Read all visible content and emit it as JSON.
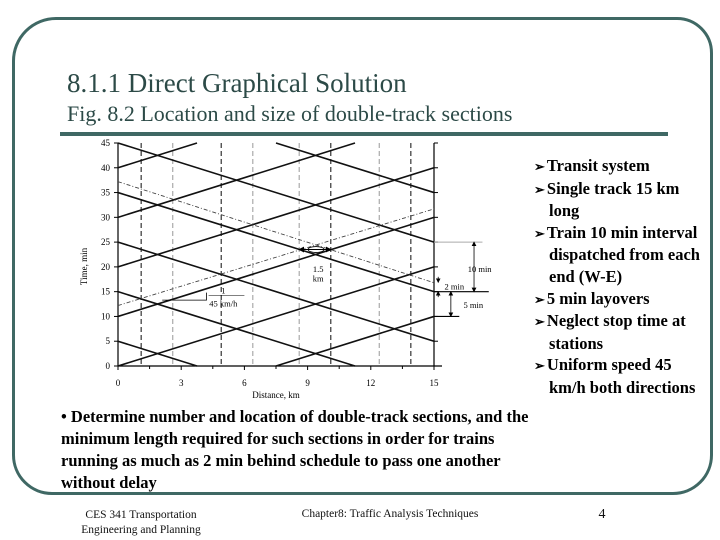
{
  "slide": {
    "title": "8.1.1 Direct Graphical Solution",
    "subtitle": "Fig. 8.2 Location and size of double-track sections",
    "accent_color": "#3f6864"
  },
  "bullets": [
    "Transit system",
    "Single track 15 km long",
    "Train 10 min interval dispatched from each end (W-E)",
    "5 min layovers",
    "Neglect stop time at stations",
    "Uniform speed 45 km/h both directions"
  ],
  "bullet_icon": "arrowhead-bullet",
  "task": "• Determine number and location of double-track sections, and the minimum length required for such sections in order for trains running as much as 2 min behind schedule to pass one another without delay",
  "footer": {
    "course_line1": "CES 341 Transportation",
    "course_line2": "Engineering and Planning",
    "chapter": "Chapter8: Traffic Analysis Techniques",
    "page": "4"
  },
  "chart_data": {
    "type": "line",
    "xlabel": "Distance, km",
    "ylabel": "Time, min",
    "xlim": [
      0,
      15
    ],
    "ylim": [
      0,
      45
    ],
    "xticks": [
      "0",
      "3",
      "6",
      "9",
      "12",
      "15"
    ],
    "yticks": [
      "0",
      "5",
      "10",
      "15",
      "20",
      "25",
      "30",
      "35",
      "40",
      "45"
    ],
    "grid": false,
    "eastbound_trains": [
      [
        [
          0,
          0
        ],
        [
          15,
          20
        ]
      ],
      [
        [
          0,
          10
        ],
        [
          15,
          30
        ]
      ],
      [
        [
          0,
          20
        ],
        [
          15,
          40
        ]
      ],
      [
        [
          0,
          30
        ],
        [
          11.25,
          45
        ]
      ],
      [
        [
          0,
          40
        ],
        [
          3.75,
          45
        ]
      ],
      [
        [
          7.5,
          0
        ],
        [
          15,
          10
        ]
      ]
    ],
    "westbound_trains": [
      [
        [
          0,
          5
        ],
        [
          3.75,
          0
        ]
      ],
      [
        [
          0,
          15
        ],
        [
          11.25,
          0
        ]
      ],
      [
        [
          0,
          25
        ],
        [
          15,
          5
        ]
      ],
      [
        [
          0,
          35
        ],
        [
          15,
          15
        ]
      ],
      [
        [
          0,
          45
        ],
        [
          15,
          25
        ]
      ],
      [
        [
          7.5,
          45
        ],
        [
          15,
          35
        ]
      ]
    ],
    "delayed_trains": [
      [
        [
          0,
          12.2
        ],
        [
          15,
          31.7
        ]
      ],
      [
        [
          0,
          37.2
        ],
        [
          15,
          16.8
        ]
      ]
    ],
    "double_track_boundaries_dark": [
      1.1,
      4.9,
      10.1,
      13.9
    ],
    "double_track_boundaries_light": [
      2.6,
      6.4,
      8.6,
      12.4
    ],
    "annotations": {
      "section_length": "1.5",
      "section_length_unit": "km",
      "headway": "10 min",
      "delay": "2 min",
      "layover": "5 min",
      "slope_rise": "1",
      "slope_run": "45 km/h"
    }
  }
}
